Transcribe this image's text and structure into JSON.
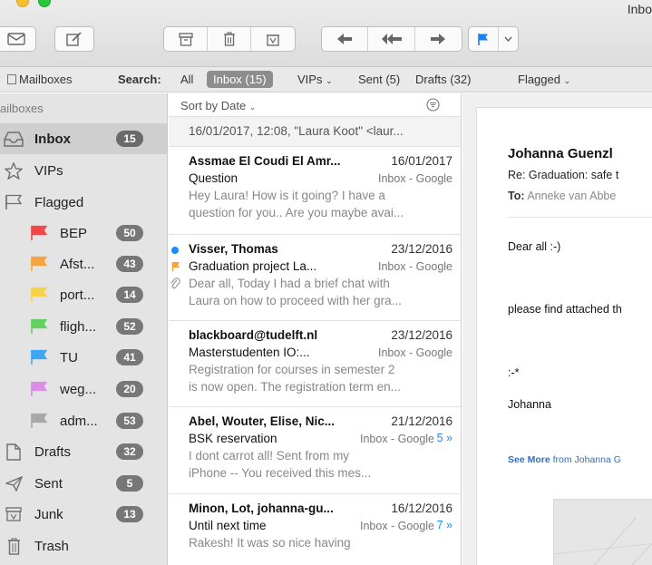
{
  "window": {
    "title": "Inbo"
  },
  "toolbar": {
    "buttons": [
      {
        "icon": "envelope-icon"
      },
      {
        "icon": "compose-icon"
      },
      {
        "icon": "archive-icon"
      },
      {
        "icon": "trash-icon"
      },
      {
        "icon": "junk-icon"
      },
      {
        "icon": "reply-icon"
      },
      {
        "icon": "reply-all-icon"
      },
      {
        "icon": "forward-icon"
      },
      {
        "icon": "flag-icon"
      },
      {
        "icon": "chevron-down-icon"
      }
    ]
  },
  "favorites": {
    "mailboxes_label": "Mailboxes",
    "search_label": "Search:",
    "all": "All",
    "inbox": "Inbox (15)",
    "vips": "VIPs",
    "sent": "Sent (5)",
    "drafts": "Drafts (32)",
    "flagged": "Flagged",
    "chevron": "⌄"
  },
  "sidebar": {
    "header": "ailboxes",
    "items": [
      {
        "label": "Inbox",
        "count": "15",
        "icon": "inbox-icon"
      },
      {
        "label": "VIPs",
        "count": "",
        "icon": "star-icon"
      },
      {
        "label": "Flagged",
        "count": "",
        "icon": "flag-icon"
      },
      {
        "label": "BEP",
        "count": "50",
        "icon": "flag-icon",
        "color": "#f04848"
      },
      {
        "label": "Afst...",
        "count": "43",
        "icon": "flag-icon",
        "color": "#f5a540"
      },
      {
        "label": "port...",
        "count": "14",
        "icon": "flag-icon",
        "color": "#f7d14a"
      },
      {
        "label": "fligh...",
        "count": "52",
        "icon": "flag-icon",
        "color": "#63d062"
      },
      {
        "label": "TU",
        "count": "41",
        "icon": "flag-icon",
        "color": "#3fa6f4"
      },
      {
        "label": "weg...",
        "count": "20",
        "icon": "flag-icon",
        "color": "#d88fe4"
      },
      {
        "label": "adm...",
        "count": "53",
        "icon": "flag-icon",
        "color": "#a8a8a8"
      },
      {
        "label": "Drafts",
        "count": "32",
        "icon": "drafts-icon"
      },
      {
        "label": "Sent",
        "count": "5",
        "icon": "sent-icon"
      },
      {
        "label": "Junk",
        "count": "13",
        "icon": "junk-icon"
      },
      {
        "label": "Trash",
        "count": "",
        "icon": "trash-icon"
      }
    ]
  },
  "list": {
    "sort_label": "Sort by Date",
    "messages": [
      {
        "line": "16/01/2017, 12:08, \"Laura Koot\" <laur..."
      },
      {
        "sender": "Assmae El Coudi El Amr...",
        "date": "16/01/2017",
        "subject": "Question",
        "mailbox": "Inbox - Google",
        "preview1": "Hey Laura! How is it going? I have a",
        "preview2": "question for you.. Are you maybe avai..."
      },
      {
        "sender": "Visser, Thomas",
        "date": "23/12/2016",
        "subject": "Graduation project La...",
        "mailbox": "Inbox - Google",
        "preview1": "Dear all, Today I had a brief chat with",
        "preview2": "Laura on how to proceed with her gra..."
      },
      {
        "sender": "blackboard@tudelft.nl",
        "date": "23/12/2016",
        "subject": "Masterstudenten IO:...",
        "mailbox": "Inbox - Google",
        "preview1": "Registration for courses in semester 2",
        "preview2": "is now open. The registration term en..."
      },
      {
        "sender": "Abel, Wouter, Elise, Nic...",
        "date": "21/12/2016",
        "subject": "BSK reservation",
        "mailbox": "Inbox - Google",
        "count": "5 »",
        "preview1": "I dont carrot all! Sent from my",
        "preview2": "iPhone -- You received this mes..."
      },
      {
        "sender": "Minon, Lot, johanna-gu...",
        "date": "16/12/2016",
        "subject": "Until next time",
        "mailbox": "Inbox - Google",
        "count": "7 »",
        "preview1": "Rakesh! It was so nice having",
        "preview2": ""
      }
    ]
  },
  "reader": {
    "from": "Johanna Guenzl",
    "subject": "Re: Graduation: safe t",
    "to_label": "To:",
    "to": "Anneke van Abbe",
    "body": [
      "Dear all :-)",
      "please find attached th",
      ":-*",
      "Johanna"
    ],
    "see_more": "See More",
    "see_more_rest": " from Johanna G"
  }
}
